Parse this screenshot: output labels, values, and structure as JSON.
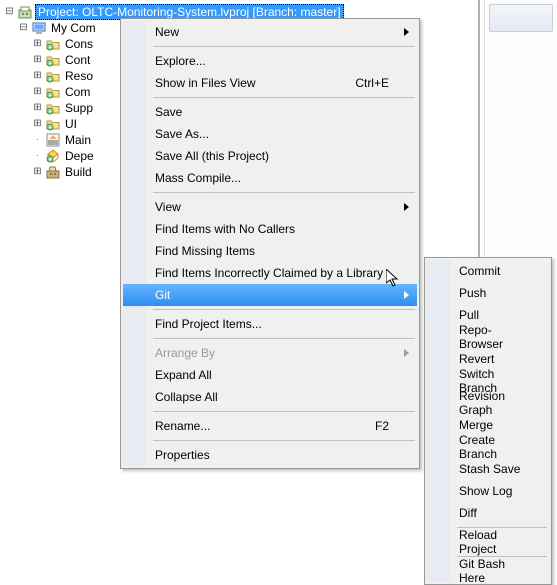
{
  "tree": {
    "project_label": "Project: OLTC-Monitoring-System.lvproj [Branch: master]",
    "my_computer": "My Com",
    "items": [
      "Cons",
      "Cont",
      "Reso",
      "Com",
      "Supp",
      "UI",
      "Main",
      "Depe",
      "Build"
    ]
  },
  "menu_main": [
    {
      "type": "item",
      "label": "New",
      "has_submenu": true
    },
    {
      "type": "sep"
    },
    {
      "type": "item",
      "label": "Explore..."
    },
    {
      "type": "item",
      "label": "Show in Files View",
      "shortcut": "Ctrl+E"
    },
    {
      "type": "sep"
    },
    {
      "type": "item",
      "label": "Save"
    },
    {
      "type": "item",
      "label": "Save As..."
    },
    {
      "type": "item",
      "label": "Save All (this Project)"
    },
    {
      "type": "item",
      "label": "Mass Compile..."
    },
    {
      "type": "sep"
    },
    {
      "type": "item",
      "label": "View",
      "has_submenu": true
    },
    {
      "type": "item",
      "label": "Find Items with No Callers"
    },
    {
      "type": "item",
      "label": "Find Missing Items"
    },
    {
      "type": "item",
      "label": "Find Items Incorrectly Claimed by a Library"
    },
    {
      "type": "item",
      "label": "Git",
      "has_submenu": true,
      "highlight": true
    },
    {
      "type": "sep"
    },
    {
      "type": "item",
      "label": "Find Project Items..."
    },
    {
      "type": "sep"
    },
    {
      "type": "item",
      "label": "Arrange By",
      "has_submenu": true,
      "disabled": true
    },
    {
      "type": "item",
      "label": "Expand All"
    },
    {
      "type": "item",
      "label": "Collapse All"
    },
    {
      "type": "sep"
    },
    {
      "type": "item",
      "label": "Rename...",
      "shortcut": "F2"
    },
    {
      "type": "sep"
    },
    {
      "type": "item",
      "label": "Properties"
    }
  ],
  "menu_sub": [
    {
      "type": "item",
      "label": "Commit"
    },
    {
      "type": "item",
      "label": "Push"
    },
    {
      "type": "item",
      "label": "Pull"
    },
    {
      "type": "item",
      "label": "Repo-Browser"
    },
    {
      "type": "item",
      "label": "Revert"
    },
    {
      "type": "item",
      "label": "Switch Branch"
    },
    {
      "type": "item",
      "label": "Revision Graph"
    },
    {
      "type": "item",
      "label": "Merge"
    },
    {
      "type": "item",
      "label": "Create Branch"
    },
    {
      "type": "item",
      "label": "Stash Save"
    },
    {
      "type": "item",
      "label": "Show Log"
    },
    {
      "type": "item",
      "label": "Diff"
    },
    {
      "type": "sep"
    },
    {
      "type": "item",
      "label": "Reload Project"
    },
    {
      "type": "sep"
    },
    {
      "type": "item",
      "label": "Git Bash Here"
    }
  ]
}
